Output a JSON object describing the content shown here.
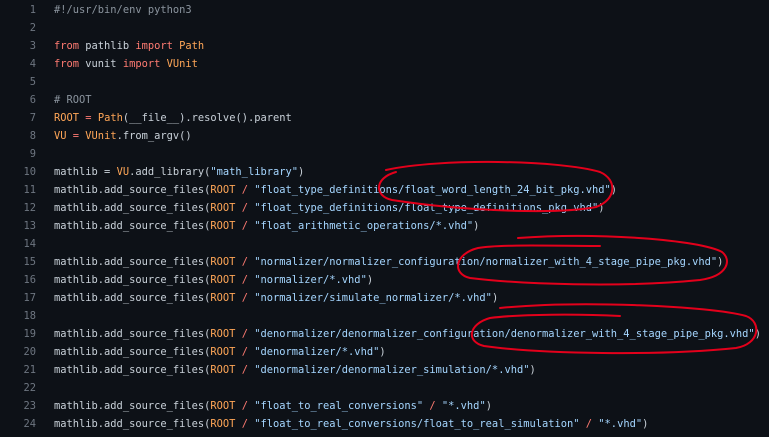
{
  "editor": {
    "lines": [
      {
        "number": "1",
        "tokens": [
          {
            "t": "#!/usr/bin/env python3",
            "k": "comment"
          }
        ]
      },
      {
        "number": "2",
        "tokens": []
      },
      {
        "number": "3",
        "tokens": [
          {
            "t": "from",
            "k": "keyword"
          },
          {
            "t": " pathlib ",
            "k": "ident"
          },
          {
            "t": "import",
            "k": "keyword"
          },
          {
            "t": " ",
            "k": "ident"
          },
          {
            "t": "Path",
            "k": "class"
          }
        ]
      },
      {
        "number": "4",
        "tokens": [
          {
            "t": "from",
            "k": "keyword"
          },
          {
            "t": " vunit ",
            "k": "ident"
          },
          {
            "t": "import",
            "k": "keyword"
          },
          {
            "t": " ",
            "k": "ident"
          },
          {
            "t": "VUnit",
            "k": "class"
          }
        ]
      },
      {
        "number": "5",
        "tokens": []
      },
      {
        "number": "6",
        "tokens": [
          {
            "t": "# ROOT",
            "k": "comment"
          }
        ]
      },
      {
        "number": "7",
        "tokens": [
          {
            "t": "ROOT",
            "k": "class"
          },
          {
            "t": " = ",
            "k": "op"
          },
          {
            "t": "Path",
            "k": "class"
          },
          {
            "t": "(__file__).resolve().parent",
            "k": "ident"
          }
        ]
      },
      {
        "number": "8",
        "tokens": [
          {
            "t": "VU",
            "k": "class"
          },
          {
            "t": " = ",
            "k": "op"
          },
          {
            "t": "VUnit",
            "k": "class"
          },
          {
            "t": ".from_argv()",
            "k": "ident"
          }
        ]
      },
      {
        "number": "9",
        "tokens": []
      },
      {
        "number": "10",
        "tokens": [
          {
            "t": "mathlib = ",
            "k": "ident"
          },
          {
            "t": "VU",
            "k": "class"
          },
          {
            "t": ".add_library(",
            "k": "ident"
          },
          {
            "t": "\"math_library\"",
            "k": "string"
          },
          {
            "t": ")",
            "k": "ident"
          }
        ]
      },
      {
        "number": "11",
        "tokens": [
          {
            "t": "mathlib.add_source_files(",
            "k": "ident"
          },
          {
            "t": "ROOT",
            "k": "class"
          },
          {
            "t": " / ",
            "k": "op"
          },
          {
            "t": "\"float_type_definitions/float_word_length_24_bit_pkg.vhd\"",
            "k": "string"
          },
          {
            "t": ")",
            "k": "ident"
          }
        ]
      },
      {
        "number": "12",
        "tokens": [
          {
            "t": "mathlib.add_source_files(",
            "k": "ident"
          },
          {
            "t": "ROOT",
            "k": "class"
          },
          {
            "t": " / ",
            "k": "op"
          },
          {
            "t": "\"float_type_definitions/float_type_definitions_pkg.vhd\"",
            "k": "string"
          },
          {
            "t": ")",
            "k": "ident"
          }
        ]
      },
      {
        "number": "13",
        "tokens": [
          {
            "t": "mathlib.add_source_files(",
            "k": "ident"
          },
          {
            "t": "ROOT",
            "k": "class"
          },
          {
            "t": " / ",
            "k": "op"
          },
          {
            "t": "\"float_arithmetic_operations/*.vhd\"",
            "k": "string"
          },
          {
            "t": ")",
            "k": "ident"
          }
        ]
      },
      {
        "number": "14",
        "tokens": []
      },
      {
        "number": "15",
        "tokens": [
          {
            "t": "mathlib.add_source_files(",
            "k": "ident"
          },
          {
            "t": "ROOT",
            "k": "class"
          },
          {
            "t": " / ",
            "k": "op"
          },
          {
            "t": "\"normalizer/normalizer_configuration/normalizer_with_4_stage_pipe_pkg.vhd\"",
            "k": "string"
          },
          {
            "t": ")",
            "k": "ident"
          }
        ]
      },
      {
        "number": "16",
        "tokens": [
          {
            "t": "mathlib.add_source_files(",
            "k": "ident"
          },
          {
            "t": "ROOT",
            "k": "class"
          },
          {
            "t": " / ",
            "k": "op"
          },
          {
            "t": "\"normalizer/*.vhd\"",
            "k": "string"
          },
          {
            "t": ")",
            "k": "ident"
          }
        ]
      },
      {
        "number": "17",
        "tokens": [
          {
            "t": "mathlib.add_source_files(",
            "k": "ident"
          },
          {
            "t": "ROOT",
            "k": "class"
          },
          {
            "t": " / ",
            "k": "op"
          },
          {
            "t": "\"normalizer/simulate_normalizer/*.vhd\"",
            "k": "string"
          },
          {
            "t": ")",
            "k": "ident"
          }
        ]
      },
      {
        "number": "18",
        "tokens": []
      },
      {
        "number": "19",
        "tokens": [
          {
            "t": "mathlib.add_source_files(",
            "k": "ident"
          },
          {
            "t": "ROOT",
            "k": "class"
          },
          {
            "t": " / ",
            "k": "op"
          },
          {
            "t": "\"denormalizer/denormalizer_configuration/denormalizer_with_4_stage_pipe_pkg.vhd\"",
            "k": "string"
          },
          {
            "t": ")",
            "k": "ident"
          }
        ]
      },
      {
        "number": "20",
        "tokens": [
          {
            "t": "mathlib.add_source_files(",
            "k": "ident"
          },
          {
            "t": "ROOT",
            "k": "class"
          },
          {
            "t": " / ",
            "k": "op"
          },
          {
            "t": "\"denormalizer/*.vhd\"",
            "k": "string"
          },
          {
            "t": ")",
            "k": "ident"
          }
        ]
      },
      {
        "number": "21",
        "tokens": [
          {
            "t": "mathlib.add_source_files(",
            "k": "ident"
          },
          {
            "t": "ROOT",
            "k": "class"
          },
          {
            "t": " / ",
            "k": "op"
          },
          {
            "t": "\"denormalizer/denormalizer_simulation/*.vhd\"",
            "k": "string"
          },
          {
            "t": ")",
            "k": "ident"
          }
        ]
      },
      {
        "number": "22",
        "tokens": []
      },
      {
        "number": "23",
        "tokens": [
          {
            "t": "mathlib.add_source_files(",
            "k": "ident"
          },
          {
            "t": "ROOT",
            "k": "class"
          },
          {
            "t": " / ",
            "k": "op"
          },
          {
            "t": "\"float_to_real_conversions\"",
            "k": "string"
          },
          {
            "t": " / ",
            "k": "op"
          },
          {
            "t": "\"*.vhd\"",
            "k": "string"
          },
          {
            "t": ")",
            "k": "ident"
          }
        ]
      },
      {
        "number": "24",
        "tokens": [
          {
            "t": "mathlib.add_source_files(",
            "k": "ident"
          },
          {
            "t": "ROOT",
            "k": "class"
          },
          {
            "t": " / ",
            "k": "op"
          },
          {
            "t": "\"float_to_real_conversions/float_to_real_simulation\"",
            "k": "string"
          },
          {
            "t": " / ",
            "k": "op"
          },
          {
            "t": "\"*.vhd\"",
            "k": "string"
          },
          {
            "t": ")",
            "k": "ident"
          }
        ]
      }
    ]
  },
  "colors": {
    "background": "#0d1117",
    "line_number": "#6e7681",
    "annotation": "#e3001b"
  }
}
